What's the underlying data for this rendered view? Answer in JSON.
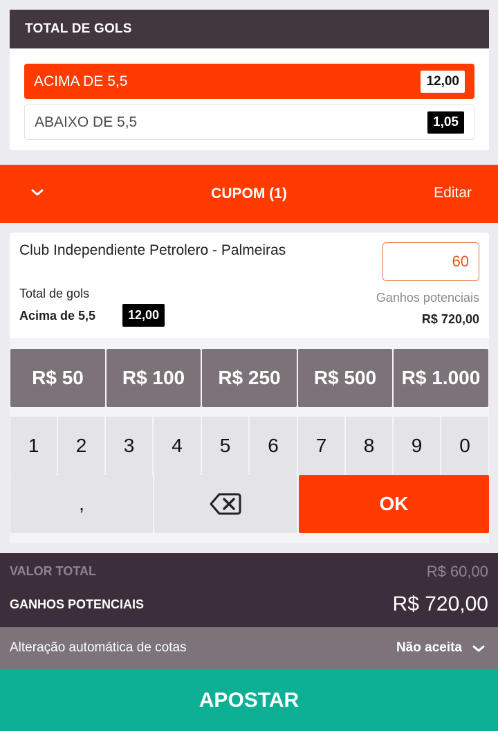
{
  "market": {
    "title": "TOTAL DE GOLS",
    "options": [
      {
        "label": "ACIMA DE 5,5",
        "odd": "12,00",
        "selected": true
      },
      {
        "label": "ABAIXO DE 5,5",
        "odd": "1,05",
        "selected": false
      }
    ]
  },
  "coupon": {
    "title": "CUPOM (1)",
    "edit_label": "Editar",
    "toggle_icon": "chevron-down-icon"
  },
  "bet_slip": {
    "match": "Club Independiente Petrolero - Palmeiras",
    "stake": "60",
    "market": "Total de gols",
    "pick": "Acima de 5,5",
    "odd": "12,00",
    "potential_label": "Ganhos potenciais",
    "potential_value": "R$ 720,00"
  },
  "keypad": {
    "quick_amounts": [
      "R$ 50",
      "R$ 100",
      "R$ 250",
      "R$ 500",
      "R$ 1.000"
    ],
    "digits": [
      "1",
      "2",
      "3",
      "4",
      "5",
      "6",
      "7",
      "8",
      "9",
      "0"
    ],
    "comma": ",",
    "backspace_icon": "backspace-icon",
    "ok_label": "OK"
  },
  "totals": {
    "total_label": "VALOR TOTAL",
    "total_value": "R$ 60,00",
    "potential_label": "GANHOS POTENCIAIS",
    "potential_value": "R$ 720,00"
  },
  "odds_change": {
    "label": "Alteração automática de cotas",
    "value": "Não aceita"
  },
  "bet_button": "APOSTAR",
  "colors": {
    "accent": "#ff3b00",
    "header_dark": "#42363f",
    "totals_bg": "#3d2e3c",
    "quick_bg": "#7b7378",
    "bet_green": "#0db094"
  }
}
